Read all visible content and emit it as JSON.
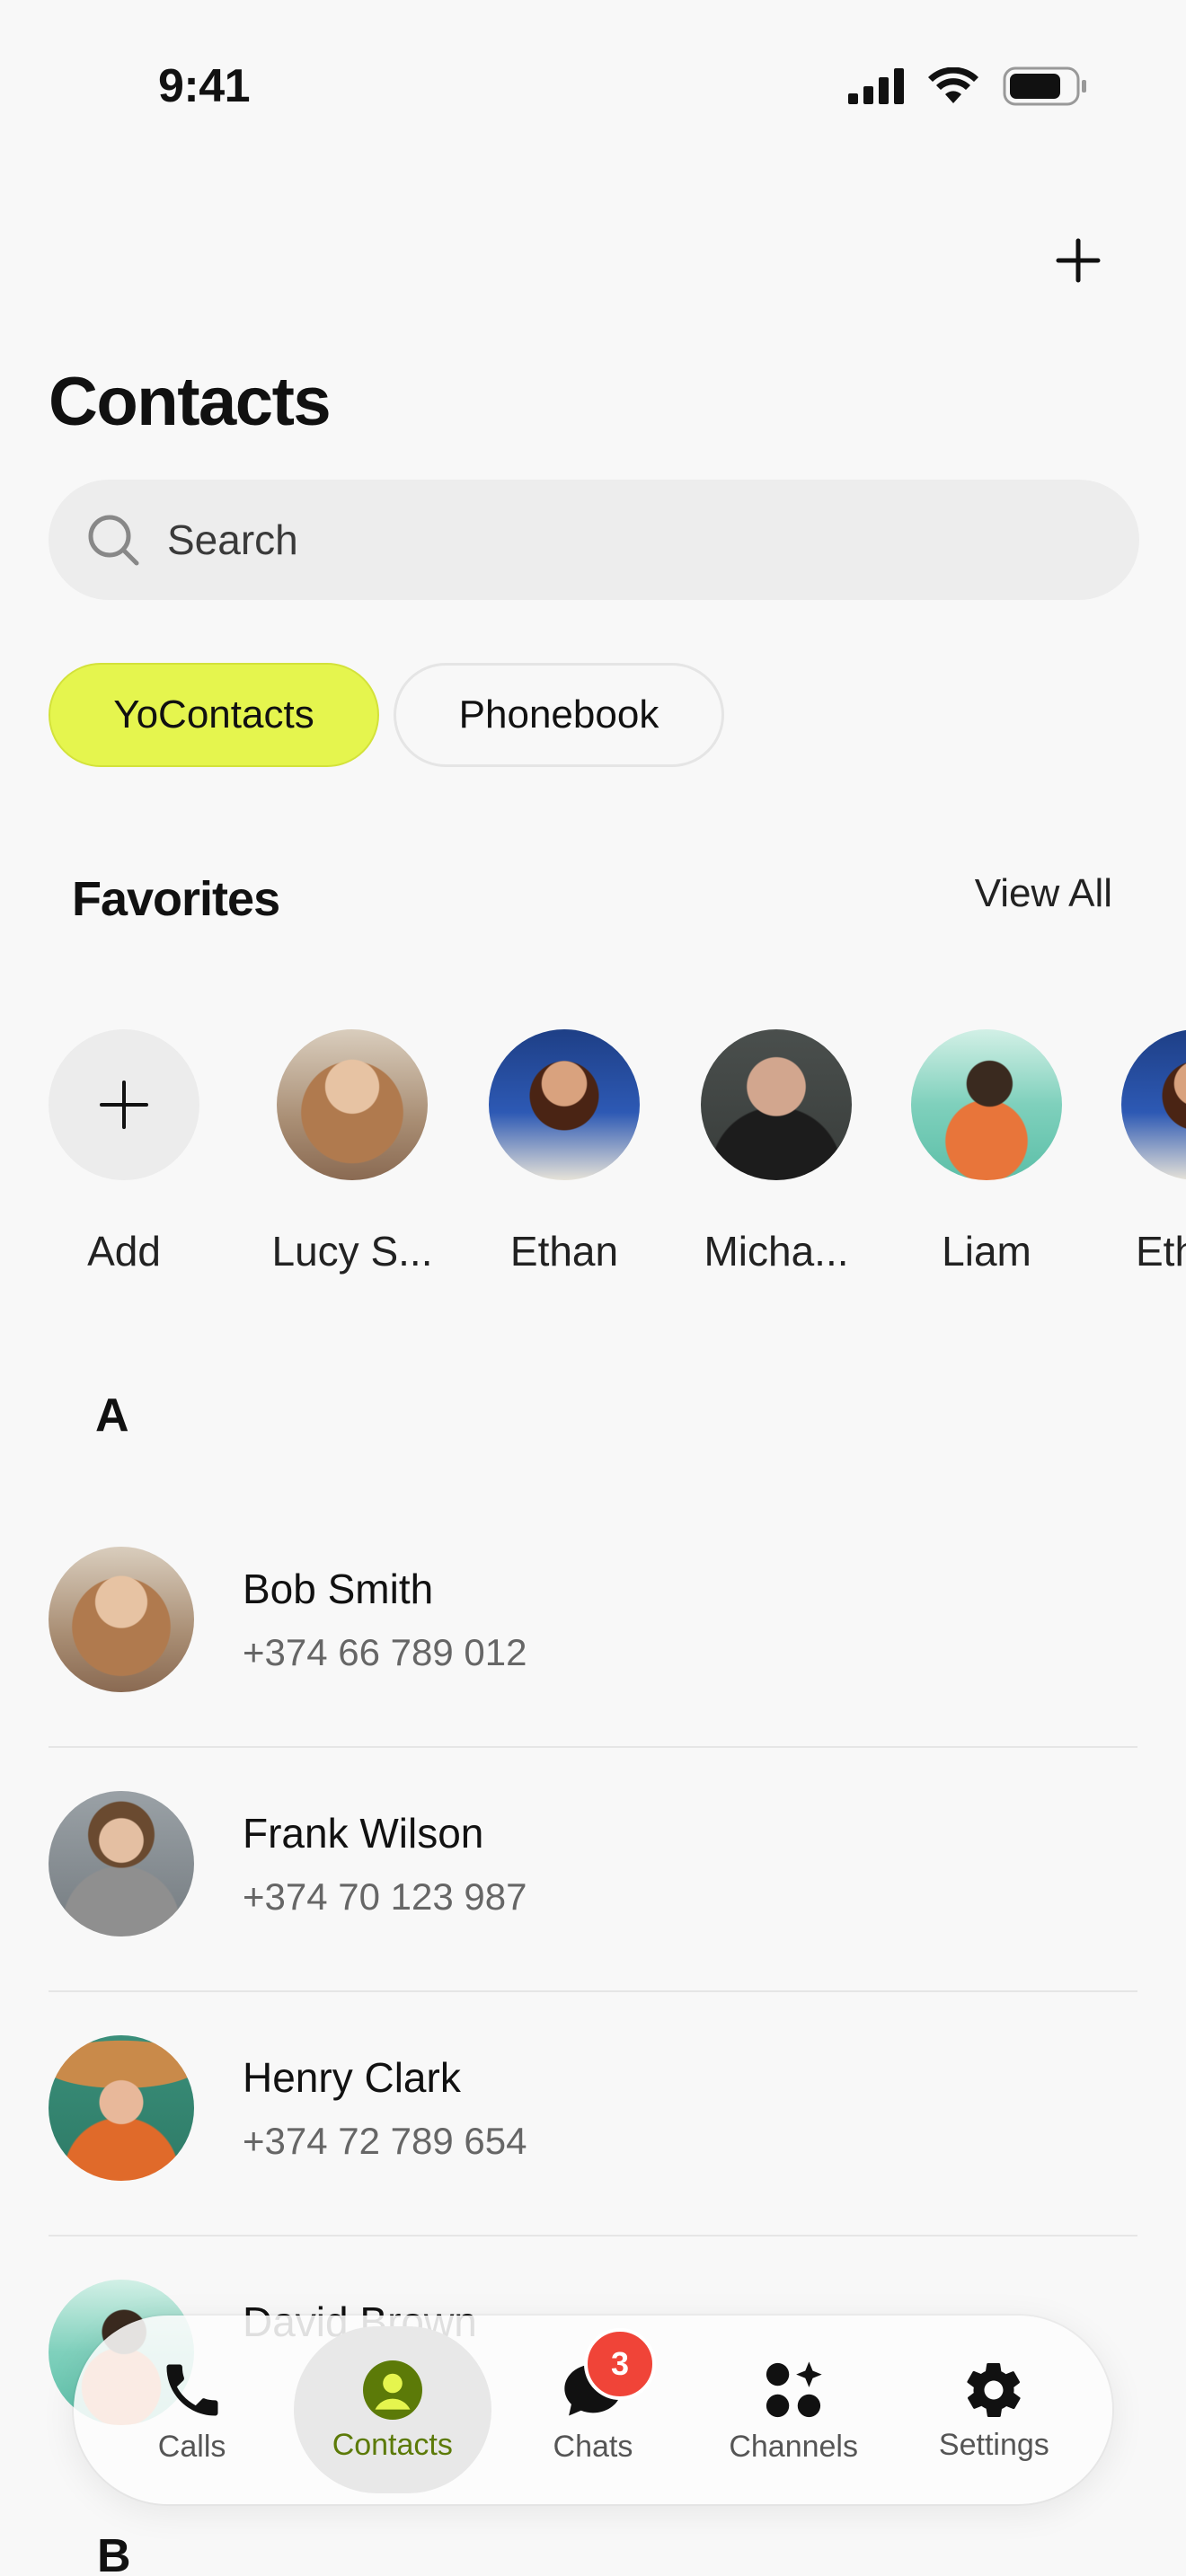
{
  "status_bar": {
    "time": "9:41"
  },
  "header": {
    "title": "Contacts",
    "add_icon": "plus-icon"
  },
  "search": {
    "placeholder": "Search",
    "icon": "search-icon"
  },
  "segments": [
    {
      "label": "YoContacts",
      "active": true
    },
    {
      "label": "Phonebook",
      "active": false
    }
  ],
  "favorites": {
    "heading": "Favorites",
    "view_all": "View All",
    "add_label": "Add",
    "items": [
      {
        "name": "Lucy S..."
      },
      {
        "name": "Ethan"
      },
      {
        "name": "Micha..."
      },
      {
        "name": "Liam"
      },
      {
        "name": "Eth"
      }
    ]
  },
  "sections": [
    {
      "letter": "A",
      "contacts": [
        {
          "name": "Bob Smith",
          "phone": "+374 66 789 012"
        },
        {
          "name": "Frank Wilson",
          "phone": "+374 70 123 987"
        },
        {
          "name": "Henry Clark",
          "phone": "+374 72 789 654"
        },
        {
          "name": "David Brown",
          "phone": ""
        }
      ]
    },
    {
      "letter": "B",
      "contacts": []
    }
  ],
  "tabbar": {
    "items": [
      {
        "label": "Calls",
        "icon": "phone-icon",
        "active": false
      },
      {
        "label": "Contacts",
        "icon": "person-icon",
        "active": true
      },
      {
        "label": "Chats",
        "icon": "chat-bubble-icon",
        "active": false,
        "badge": "3"
      },
      {
        "label": "Channels",
        "icon": "channels-icon",
        "active": false
      },
      {
        "label": "Settings",
        "icon": "gear-icon",
        "active": false
      }
    ]
  },
  "colors": {
    "accent": "#E5F54E",
    "active_tab_text": "#5C7A08",
    "badge": "#F04438"
  }
}
